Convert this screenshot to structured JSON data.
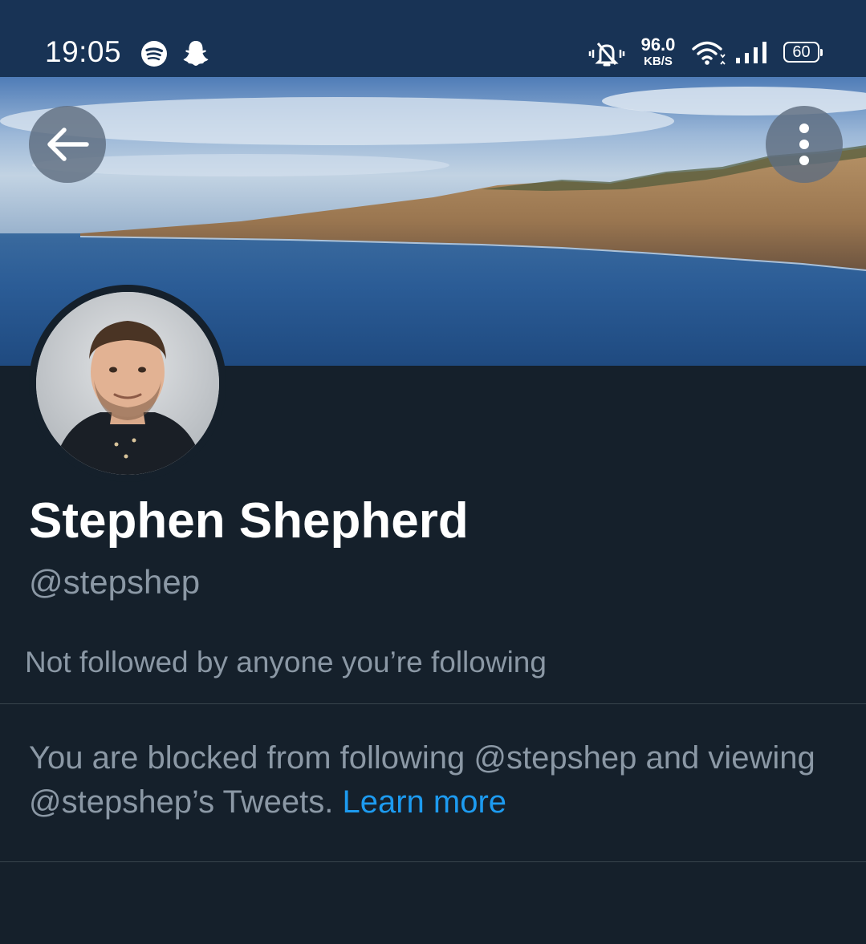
{
  "status_bar": {
    "time": "19:05",
    "net_speed_value": "96.0",
    "net_speed_unit": "KB/S",
    "battery": "60",
    "icons": [
      "spotify-icon",
      "snapchat-icon",
      "vibrate-icon",
      "wifi-icon",
      "signal-icon",
      "battery-icon"
    ]
  },
  "profile": {
    "name": "Stephen Shepherd",
    "handle": "@stepshep",
    "followers_you_know": "Not followed by anyone you’re following",
    "blocked_message": "You are blocked from following @stepshep and viewing @stepshep’s Tweets.",
    "learn_more": "Learn more"
  },
  "header": {
    "back_icon": "arrow-left-icon",
    "more_icon": "more-vertical-icon"
  }
}
